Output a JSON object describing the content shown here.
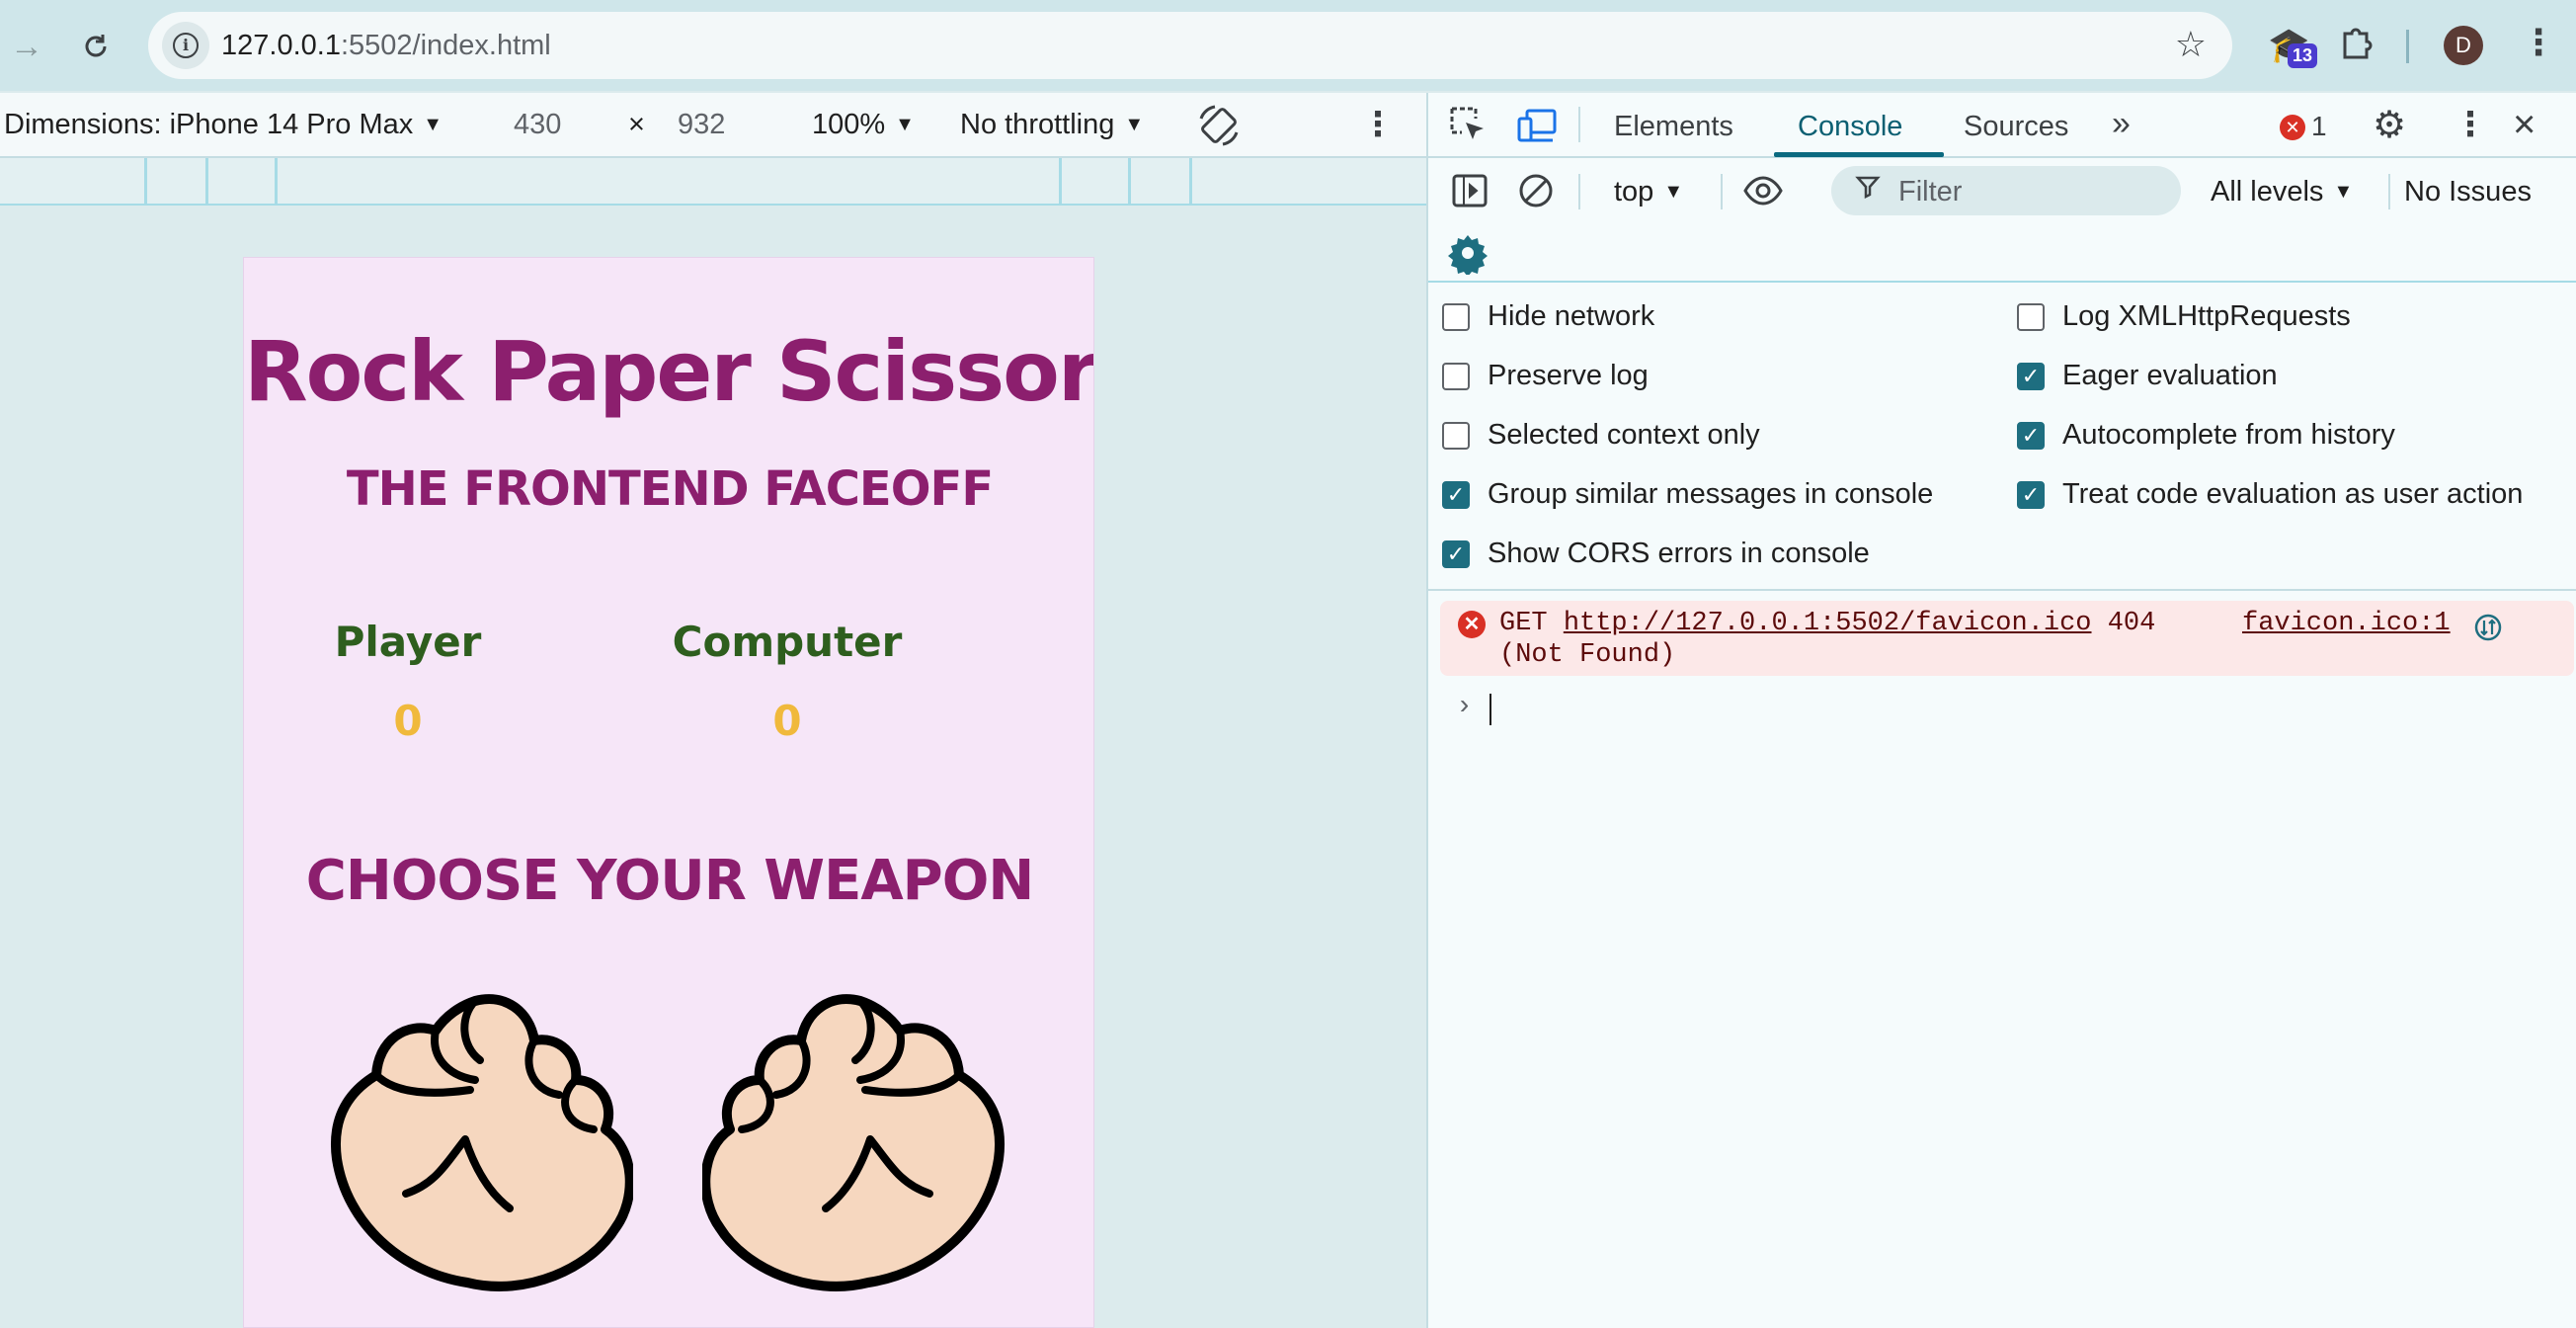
{
  "browser": {
    "url_host": "127.0.0.1",
    "url_rest": ":5502/index.html",
    "extension_badge": "13",
    "profile_initial": "D"
  },
  "device_toolbar": {
    "dimensions_label": "Dimensions: iPhone 14 Pro Max",
    "width": "430",
    "times": "×",
    "height": "932",
    "zoom": "100%",
    "throttling": "No throttling"
  },
  "page": {
    "title": "Rock Paper Scissors",
    "subtitle": "THE FRONTEND FACEOFF",
    "player_label": "Player",
    "computer_label": "Computer",
    "player_score": "0",
    "computer_score": "0",
    "choose_heading": "CHOOSE YOUR WEAPON"
  },
  "devtools": {
    "tabs": [
      "Elements",
      "Console",
      "Sources"
    ],
    "active_tab": "Console",
    "error_count": "1",
    "context": "top",
    "filter_placeholder": "Filter",
    "levels": "All levels",
    "issues": "No Issues",
    "settings_left": [
      {
        "label": "Hide network",
        "checked": false
      },
      {
        "label": "Preserve log",
        "checked": false
      },
      {
        "label": "Selected context only",
        "checked": false
      },
      {
        "label": "Group similar messages in console",
        "checked": true
      },
      {
        "label": "Show CORS errors in console",
        "checked": true
      }
    ],
    "settings_right": [
      {
        "label": "Log XMLHttpRequests",
        "checked": false
      },
      {
        "label": "Eager evaluation",
        "checked": true
      },
      {
        "label": "Autocomplete from history",
        "checked": true
      },
      {
        "label": "Treat code evaluation as user action",
        "checked": true
      }
    ],
    "console_error": {
      "method": "GET",
      "url": "http://127.0.0.1:5502/favicon.ico",
      "status": "404",
      "status_text": "(Not Found)",
      "source": "favicon.ico:1"
    },
    "prompt_symbol": "›"
  },
  "colors": {
    "title": "#8c1f6e",
    "score_label": "#2e5e1e",
    "score_value": "#f0b93c",
    "page_bg": "#f6e6f8",
    "devtools_accent": "#0b6a80",
    "error_bg": "#fce8e8"
  }
}
